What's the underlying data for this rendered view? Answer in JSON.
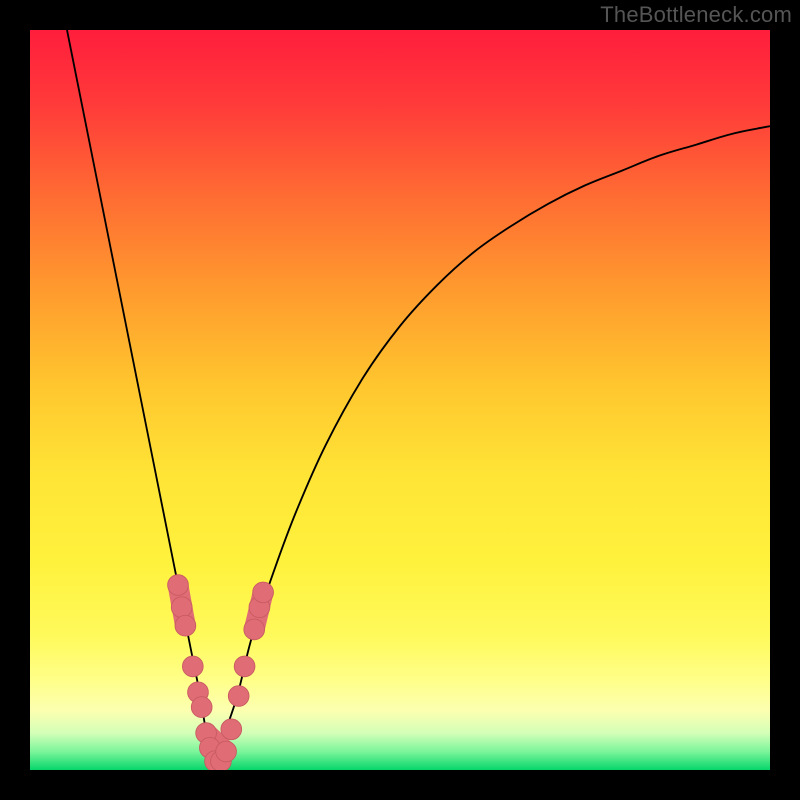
{
  "watermark": "TheBottleneck.com",
  "colors": {
    "frame": "#000000",
    "curve": "#000000",
    "marker_fill": "#e06d75",
    "marker_stroke": "#c85a62",
    "gradient_stops": [
      {
        "offset": 0.0,
        "color": "#ff1e3c"
      },
      {
        "offset": 0.1,
        "color": "#ff3a3a"
      },
      {
        "offset": 0.22,
        "color": "#ff6a33"
      },
      {
        "offset": 0.35,
        "color": "#ff9a2e"
      },
      {
        "offset": 0.48,
        "color": "#ffc62e"
      },
      {
        "offset": 0.6,
        "color": "#ffe436"
      },
      {
        "offset": 0.72,
        "color": "#fff23d"
      },
      {
        "offset": 0.82,
        "color": "#fffa5c"
      },
      {
        "offset": 0.88,
        "color": "#ffff8a"
      },
      {
        "offset": 0.92,
        "color": "#fcffb0"
      },
      {
        "offset": 0.95,
        "color": "#d4ffb8"
      },
      {
        "offset": 0.975,
        "color": "#7cf59b"
      },
      {
        "offset": 1.0,
        "color": "#06d66a"
      }
    ]
  },
  "chart_data": {
    "type": "line",
    "title": "",
    "xlabel": "",
    "ylabel": "",
    "xlim": [
      0,
      100
    ],
    "ylim": [
      0,
      100
    ],
    "min_x": 25,
    "series": [
      {
        "name": "left-branch",
        "x": [
          5,
          7,
          9,
          11,
          13,
          15,
          17,
          19,
          20,
          21,
          22,
          23,
          24,
          25
        ],
        "y": [
          100,
          90,
          80,
          70,
          60,
          50,
          40,
          30,
          25,
          20,
          15,
          10,
          4,
          0
        ]
      },
      {
        "name": "right-branch",
        "x": [
          25,
          26,
          28,
          30,
          33,
          36,
          40,
          45,
          50,
          55,
          60,
          65,
          70,
          75,
          80,
          85,
          90,
          95,
          100
        ],
        "y": [
          0,
          4,
          10,
          18,
          27,
          35,
          44,
          53,
          60,
          65.5,
          70,
          73.5,
          76.5,
          79,
          81,
          83,
          84.5,
          86,
          87
        ]
      }
    ],
    "markers": {
      "name": "highlight-points",
      "points": [
        {
          "x": 20.0,
          "y": 25.0
        },
        {
          "x": 20.5,
          "y": 22.0
        },
        {
          "x": 21.0,
          "y": 19.5
        },
        {
          "x": 22.0,
          "y": 14.0
        },
        {
          "x": 22.7,
          "y": 10.5
        },
        {
          "x": 23.2,
          "y": 8.5
        },
        {
          "x": 23.8,
          "y": 5.0
        },
        {
          "x": 24.3,
          "y": 3.0
        },
        {
          "x": 25.0,
          "y": 1.2
        },
        {
          "x": 25.8,
          "y": 1.2
        },
        {
          "x": 26.5,
          "y": 2.5
        },
        {
          "x": 27.2,
          "y": 5.5
        },
        {
          "x": 28.2,
          "y": 10.0
        },
        {
          "x": 29.0,
          "y": 14.0
        },
        {
          "x": 30.3,
          "y": 19.0
        },
        {
          "x": 31.0,
          "y": 22.0
        },
        {
          "x": 31.5,
          "y": 24.0
        }
      ],
      "radius": 1.4,
      "stadium_segments": [
        {
          "x0": 20.0,
          "y0": 25.0,
          "x1": 21.0,
          "y1": 19.5
        },
        {
          "x0": 23.8,
          "y0": 5.0,
          "x1": 26.5,
          "y1": 2.5
        },
        {
          "x0": 30.3,
          "y0": 19.0,
          "x1": 31.5,
          "y1": 24.0
        }
      ]
    }
  }
}
